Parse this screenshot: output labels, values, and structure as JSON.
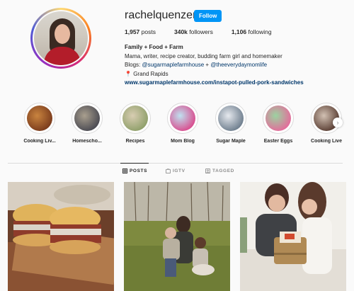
{
  "profile": {
    "username": "rachelquenzer",
    "follow_label": "Follow",
    "posts_count": "1,957",
    "posts_label": "posts",
    "followers_count": "340k",
    "followers_label": "followers",
    "following_count": "1,106",
    "following_label": "following",
    "bio_name": "Family + Food + Farm",
    "bio_line1": "Mama, writer, recipe creator, budding farm girl and homemaker",
    "bio_blogs_prefix": "Blogs: ",
    "bio_mention1": "@sugarmaplefarmhouse",
    "bio_plus": " + ",
    "bio_mention2": "@theeverydaymomlife",
    "bio_location": "Grand Rapids",
    "bio_link": "www.sugarmaplefarmhouse.com/instapot-pulled-pork-sandwiches"
  },
  "highlights": [
    {
      "label": "Cooking Liv...",
      "color1": "#7a3b1c",
      "color2": "#c9843f"
    },
    {
      "label": "Homescho...",
      "color1": "#4a4a52",
      "color2": "#a99f8e"
    },
    {
      "label": "Recipes",
      "color1": "#8f9f6a",
      "color2": "#d8cdb2"
    },
    {
      "label": "Mom Blog",
      "color1": "#d94c8e",
      "color2": "#bfe1f0"
    },
    {
      "label": "Sugar Maple",
      "color1": "#6d7d8d",
      "color2": "#e6e9ee"
    },
    {
      "label": "Easter Eggs",
      "color1": "#e56b9b",
      "color2": "#9bd3a1"
    },
    {
      "label": "Cooking Live",
      "color1": "#5a3e33",
      "color2": "#d2c1b3"
    }
  ],
  "tabs": {
    "posts": "POSTS",
    "igtv": "IGTV",
    "tagged": "TAGGED"
  },
  "colors": {
    "accent": "#0095f6",
    "link": "#00376b"
  }
}
